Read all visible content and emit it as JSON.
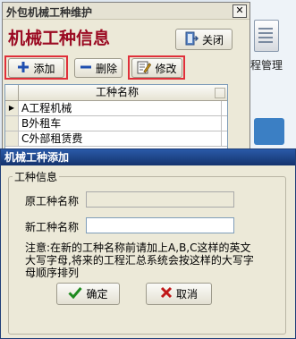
{
  "background": {
    "label": "程管理"
  },
  "main_window": {
    "title": "外包机械工种维护",
    "close_symbol": "✕",
    "heading": "机械工种信息",
    "close_button": "关闭",
    "toolbar": {
      "add": "添加",
      "delete": "删除",
      "edit": "修改"
    },
    "grid": {
      "column": "工种名称",
      "rows": [
        "A工程机械",
        "B外租车",
        "C外部租赁费"
      ],
      "current_row_marker": "▶"
    }
  },
  "dialog": {
    "title": "机械工种添加",
    "group_label": "工种信息",
    "original_label": "原工种名称",
    "original_value": "",
    "new_label": "新工种名称",
    "new_value": "",
    "note": "注意:在新的工种名称前请加上A,B,C这样的英文大写字母,将来的工程汇总系统会按这样的大写字母顺序排列",
    "ok": "确定",
    "cancel": "取消"
  },
  "colors": {
    "heading": "#9b0b23",
    "highlight": "#e0303a",
    "dialog_title": "#1f4d98"
  },
  "icons": [
    "close-icon",
    "door-exit-icon",
    "plus-icon",
    "minus-icon",
    "edit-document-icon",
    "row-pointer-icon",
    "check-icon",
    "x-icon"
  ]
}
